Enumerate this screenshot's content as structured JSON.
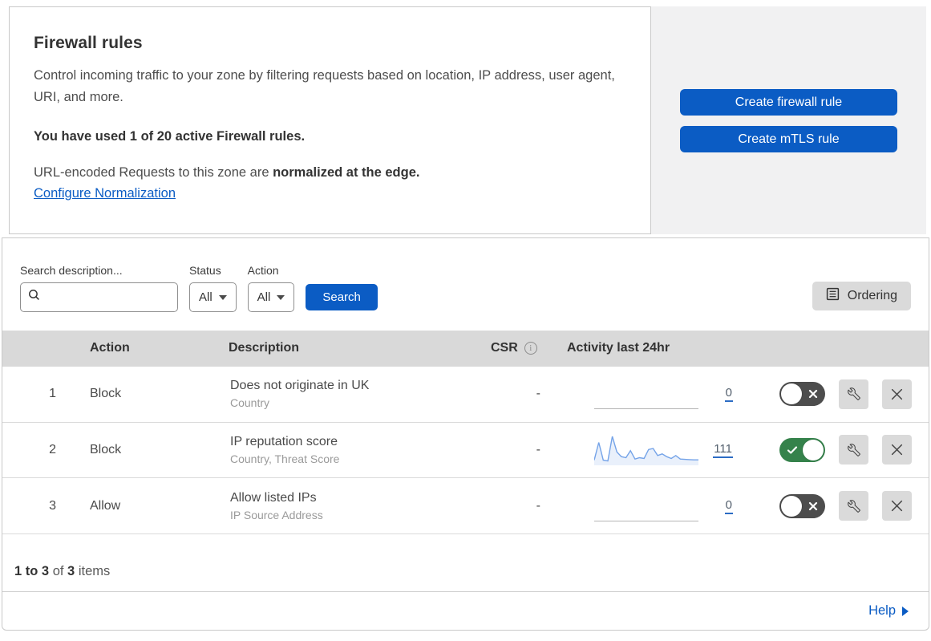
{
  "intro": {
    "title": "Firewall rules",
    "description": "Control incoming traffic to your zone by filtering requests based on location, IP address, user agent, URI, and more.",
    "usage_note": "You have used 1 of 20 active Firewall rules.",
    "normalization_prefix": "URL-encoded Requests to this zone are ",
    "normalization_bold": "normalized at the edge.",
    "normalization_link": "Configure Normalization"
  },
  "actions": {
    "create_firewall_rule": "Create firewall rule",
    "create_mtls_rule": "Create mTLS rule"
  },
  "filters": {
    "search_label": "Search description...",
    "status_label": "Status",
    "status_value": "All",
    "action_label": "Action",
    "action_value": "All",
    "search_button": "Search",
    "ordering_button": "Ordering"
  },
  "table": {
    "headers": {
      "action": "Action",
      "description": "Description",
      "csr": "CSR",
      "activity": "Activity last 24hr"
    },
    "rows": [
      {
        "num": "1",
        "action": "Block",
        "description": "Does not originate in UK",
        "criteria": "Country",
        "csr": "-",
        "count": "0",
        "enabled": false,
        "sparkline": []
      },
      {
        "num": "2",
        "action": "Block",
        "description": "IP reputation score",
        "criteria": "Country, Threat Score",
        "csr": "-",
        "count": "111",
        "enabled": true,
        "sparkline": [
          13,
          78,
          13,
          10,
          100,
          43,
          26,
          22,
          48,
          17,
          22,
          19,
          52,
          56,
          30,
          36,
          26,
          19,
          30,
          17,
          16,
          15,
          14,
          14
        ]
      },
      {
        "num": "3",
        "action": "Allow",
        "description": "Allow listed IPs",
        "criteria": "IP Source Address",
        "csr": "-",
        "count": "0",
        "enabled": false,
        "sparkline": []
      }
    ]
  },
  "footer": {
    "range": "1 to 3",
    "of_text": " of ",
    "total": "3",
    "items_text": " items",
    "help": "Help"
  },
  "colors": {
    "primary_blue": "#0b5cc4",
    "toggle_on_green": "#35824b",
    "toggle_off_gray": "#4d4d4d",
    "table_header_gray": "#d9d9d9",
    "panel_gray": "#f1f1f2",
    "sparkline_blue": "#74a3e8"
  }
}
